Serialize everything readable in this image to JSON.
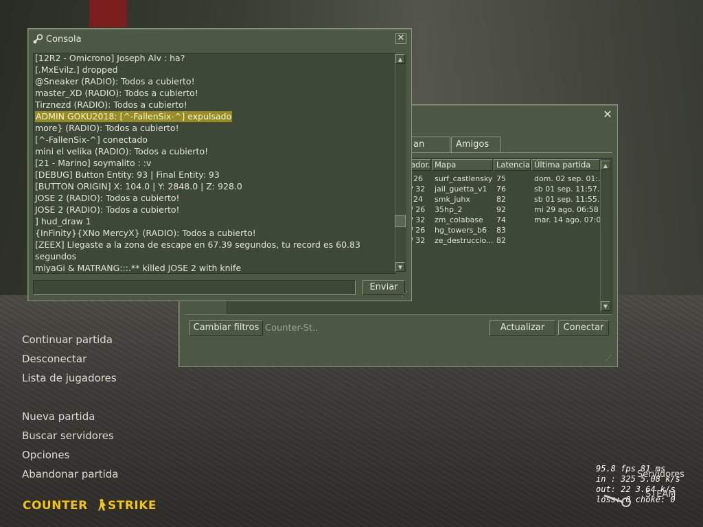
{
  "menu": {
    "items": [
      {
        "label": "Continuar partida"
      },
      {
        "label": "Desconectar"
      },
      {
        "label": "Lista de jugadores"
      },
      {
        "label": "Nueva partida"
      },
      {
        "label": "Buscar servidores"
      },
      {
        "label": "Opciones"
      },
      {
        "label": "Abandonar partida"
      }
    ]
  },
  "logo": "COUNTERSTRIKE",
  "stats": {
    "line1": "95.8 fps   81 ms",
    "line2": "in :  325 5.08 k/s",
    "line3": "out:  22 3.64 k/s",
    "line4": "loss: 0 choke:  0",
    "overlay1": "Servidores",
    "overlay2": "STEAM"
  },
  "server_browser": {
    "tabs": [
      {
        "label": "an"
      },
      {
        "label": "Amigos"
      }
    ],
    "columns": [
      {
        "label": "ador."
      },
      {
        "label": "Mapa"
      },
      {
        "label": "Latencia"
      },
      {
        "label": "Última partida"
      }
    ],
    "rows": [
      {
        "players": "26",
        "map": "surf_castlensky",
        "latency": "75",
        "last": "dom. 02 sep. 01:..."
      },
      {
        "players": "/ 32",
        "map": "jail_guetta_v1",
        "latency": "76",
        "last": "sb 01 sep. 11:57..."
      },
      {
        "players": "24",
        "map": "smk_juhx",
        "latency": "82",
        "last": "sb 01 sep. 11:55..."
      },
      {
        "players": "/ 26",
        "map": "35hp_2",
        "latency": "92",
        "last": "mi 29 ago. 06:58"
      },
      {
        "players": "/ 32",
        "map": "zm_colabase",
        "latency": "74",
        "last": "mar. 14 ago. 07:0"
      },
      {
        "players": "/ 26",
        "map": "hg_towers_b6",
        "latency": "83",
        "last": ""
      },
      {
        "players": "/ 32",
        "map": "ze_destruccio...",
        "latency": "82",
        "last": ""
      }
    ],
    "filter_button": "Cambiar filtros",
    "filter_text": "Counter-St..",
    "refresh_button": "Actualizar",
    "connect_button": "Conectar",
    "close": "✕"
  },
  "console": {
    "title": "Consola",
    "close": "✕",
    "lines": [
      {
        "text": "[12R2 - Omicrono] Joseph Alv : ha?",
        "hl": false
      },
      {
        "text": "[.MxEvilz.] dropped",
        "hl": false
      },
      {
        "text": "@Sneaker (RADIO): Todos a cubierto!",
        "hl": false
      },
      {
        "text": "master_XD (RADIO): Todos a cubierto!",
        "hl": false
      },
      {
        "text": "Tirznezd (RADIO): Todos a cubierto!",
        "hl": false
      },
      {
        "text": "ADMIN GOKU2018: [^-FallenSix-^] expulsado",
        "hl": true
      },
      {
        "text": "more} (RADIO): Todos a cubierto!",
        "hl": false
      },
      {
        "text": "[^-FallenSix-^] conectado",
        "hl": false
      },
      {
        "text": "mini el velika (RADIO): Todos a cubierto!",
        "hl": false
      },
      {
        "text": "[21 - Marino] soymalito : :v",
        "hl": false
      },
      {
        "text": "[DEBUG] Button Entity: 93 | Final Entity: 93",
        "hl": false
      },
      {
        "text": "[BUTTON ORIGIN] X: 104.0 | Y: 2848.0 | Z: 928.0",
        "hl": false
      },
      {
        "text": "JOSE 2 (RADIO): Todos a cubierto!",
        "hl": false
      },
      {
        "text": "JOSE 2 (RADIO): Todos a cubierto!",
        "hl": false
      },
      {
        "text": "] hud_draw 1",
        "hl": false
      },
      {
        "text": "{InFinity}{XNo MercyX} (RADIO): Todos a cubierto!",
        "hl": false
      },
      {
        "text": "[ZEEX] Llegaste a la zona de escape en  67.39 segundos, tu record es 60.83",
        "hl": false
      },
      {
        "text": "segundos",
        "hl": false
      },
      {
        "text": "miyaGi & MATRANG:::.** killed JOSE 2 with knife",
        "hl": false
      }
    ],
    "input_value": "",
    "send_button": "Enviar"
  }
}
